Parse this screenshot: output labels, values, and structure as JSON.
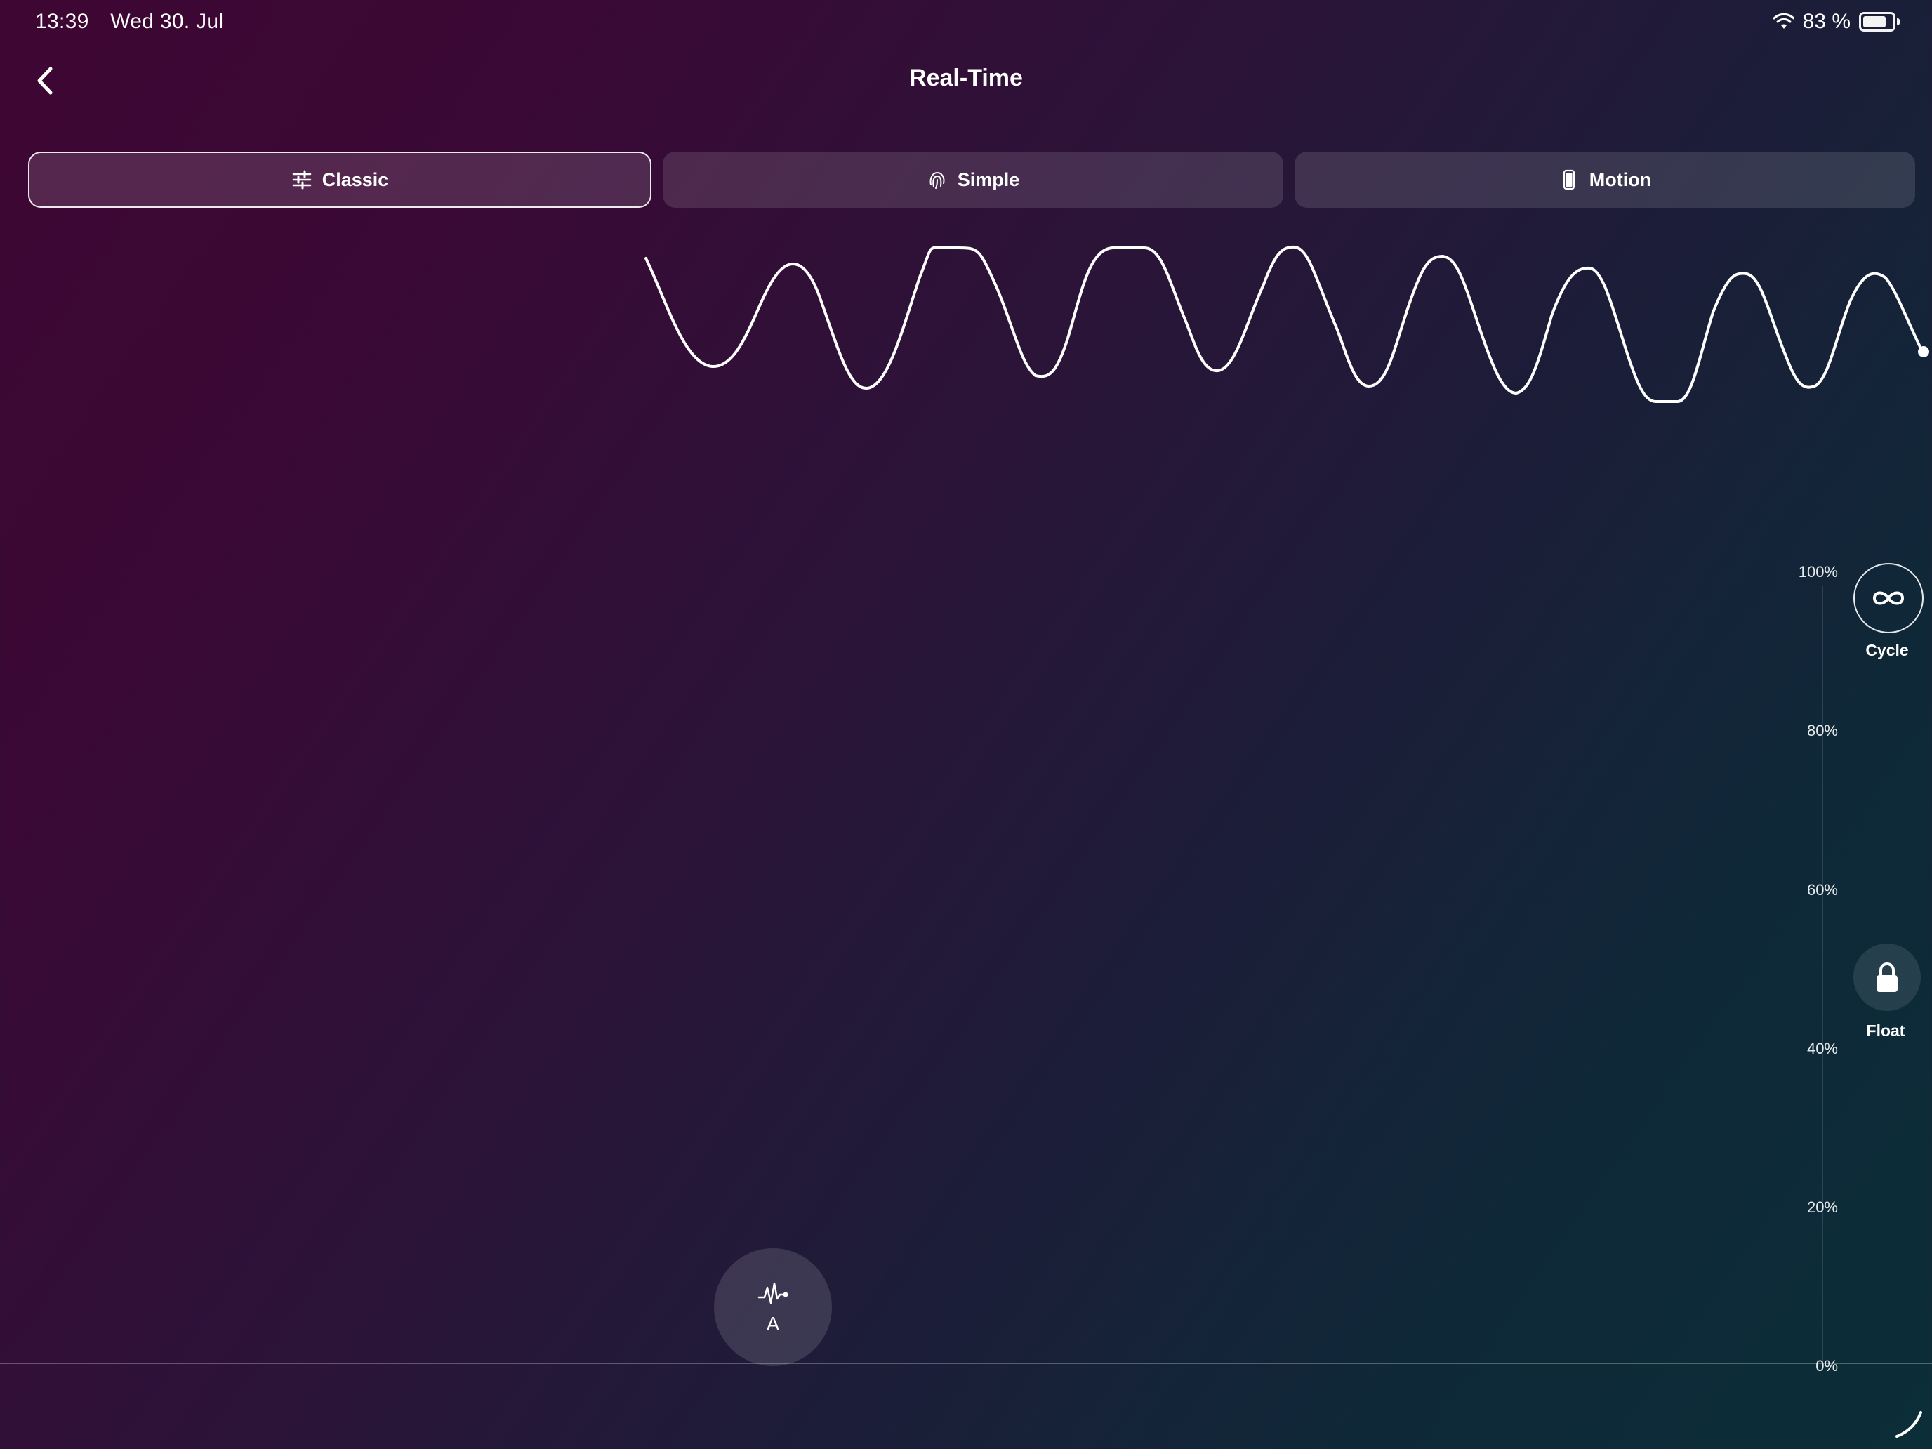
{
  "status_bar": {
    "time": "13:39",
    "date": "Wed 30. Jul",
    "battery": "83 %"
  },
  "header": {
    "title": "Real-Time"
  },
  "tabs": [
    {
      "label": "Classic",
      "icon": "sliders-icon",
      "active": true
    },
    {
      "label": "Simple",
      "icon": "fingerprint-icon",
      "active": false
    },
    {
      "label": "Motion",
      "icon": "phone-icon",
      "active": false
    }
  ],
  "axis": {
    "ticks": [
      "100%",
      "80%",
      "60%",
      "40%",
      "20%",
      "0%"
    ]
  },
  "side_controls": {
    "cycle_label": "Cycle",
    "float_label": "Float"
  },
  "pattern_button": {
    "label": "A"
  },
  "colors": {
    "accent": "#ffffff",
    "bg_start": "#3e0633",
    "bg_end": "#0b2e38"
  }
}
